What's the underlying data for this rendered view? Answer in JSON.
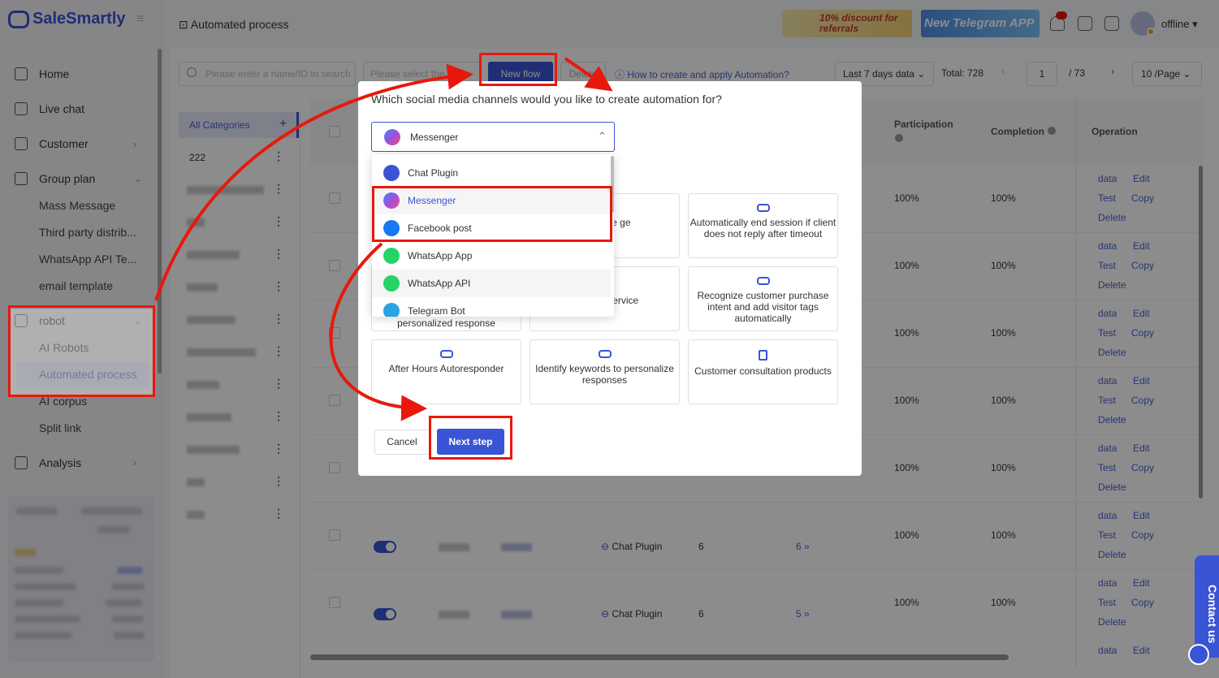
{
  "brand": {
    "name": "SaleSmartly"
  },
  "sidebar": {
    "items": [
      {
        "label": "Home",
        "icon": "home-icon"
      },
      {
        "label": "Live chat",
        "icon": "chat-icon"
      },
      {
        "label": "Customer",
        "icon": "users-icon"
      },
      {
        "label": "Group plan",
        "icon": "send-icon"
      }
    ],
    "group_plan_sub": [
      "Mass Message",
      "Third party distrib...",
      "WhatsApp API Te...",
      "email template"
    ],
    "robot": {
      "label": "robot",
      "icon": "robot-icon"
    },
    "robot_sub": [
      "AI Robots",
      "Automated process",
      "AI corpus",
      "Split link"
    ],
    "analysis": {
      "label": "Analysis",
      "icon": "chart-icon"
    }
  },
  "header": {
    "breadcrumb": "Automated process",
    "promo_discount": "10% discount for referrals",
    "promo_telegram": "New Telegram APP",
    "status": "offline"
  },
  "toolbar": {
    "search_placeholder": "Please enter a name/ID to search",
    "select_placeholder": "Please select the o...",
    "new_flow": "New flow",
    "delete": "Delete",
    "help_link": "How to create and apply Automation?",
    "date_range": "Last 7 days data",
    "total": "Total: 728",
    "page_current": "1",
    "page_total": "/ 73",
    "page_size": "10 /Page"
  },
  "categories": {
    "all": "All Categories",
    "items": [
      "222"
    ]
  },
  "table": {
    "headers": {
      "participation": "Participation",
      "completion": "Completion",
      "operation": "Operation"
    },
    "rows": [
      {
        "participation": "100%",
        "completion": "100%"
      },
      {
        "participation": "100%",
        "completion": "100%"
      },
      {
        "participation": "100%",
        "completion": "100%"
      },
      {
        "participation": "100%",
        "completion": "100%"
      },
      {
        "participation": "100%",
        "completion": "100%"
      },
      {
        "channel": "Chat Plugin",
        "count": "6",
        "link": "6 »",
        "participation": "100%",
        "completion": "100%"
      },
      {
        "channel": "Chat Plugin",
        "count": "6",
        "link": "5 »",
        "participation": "100%",
        "completion": "100%"
      }
    ],
    "ops": {
      "data": "data",
      "edit": "Edit",
      "test": "Test",
      "copy": "Copy",
      "delete": "Delete"
    }
  },
  "modal": {
    "question": "Which social media channels would you like to create automation for?",
    "selected": "Messenger",
    "options": [
      {
        "label": "Chat Plugin",
        "icon": "chat-plugin-icon",
        "color": "#3a54d6"
      },
      {
        "label": "Messenger",
        "icon": "messenger-icon",
        "color": "#a34de0"
      },
      {
        "label": "Facebook post",
        "icon": "facebook-icon",
        "color": "#1877f2"
      },
      {
        "label": "WhatsApp App",
        "icon": "whatsapp-icon",
        "color": "#25d366"
      },
      {
        "label": "WhatsApp API",
        "icon": "whatsapp-api-icon",
        "color": "#25d366"
      },
      {
        "label": "Telegram Bot",
        "icon": "telegram-icon",
        "color": "#2aa3e0"
      }
    ],
    "cards": [
      {
        "text": "welcome ge"
      },
      {
        "text": "Automatically end session if client does not reply after timeout"
      },
      {
        "text": "personalized response"
      },
      {
        "text": "assigned ervice"
      },
      {
        "text": "Recognize customer purchase intent and add visitor tags automatically"
      },
      {
        "text": "After Hours Autoresponder"
      },
      {
        "text": "Identify keywords to personalize responses"
      },
      {
        "text": "Customer consultation products"
      }
    ],
    "cancel": "Cancel",
    "next": "Next step"
  },
  "contact": "Contact us",
  "colors": {
    "accent": "#3a54d6",
    "annotation": "#e8180c"
  }
}
